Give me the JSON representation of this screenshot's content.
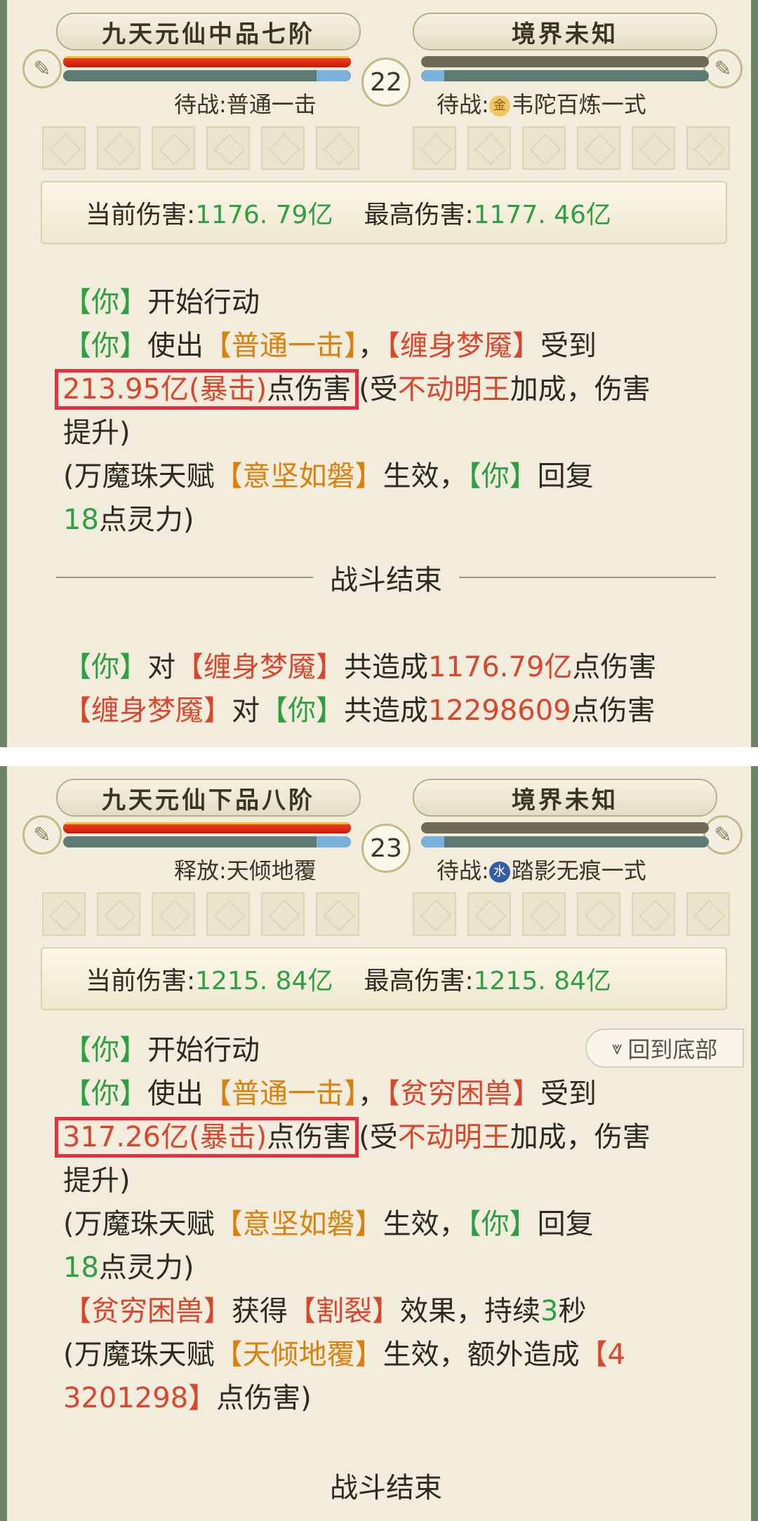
{
  "screens": [
    {
      "player_realm": "九天元仙中品七阶",
      "enemy_realm": "境界未知",
      "round": "22",
      "player_status": "待战:普通一击",
      "enemy_status_prefix": "待战:",
      "enemy_element": "金",
      "enemy_skill": "韦陀百炼一式",
      "current_label": "当前伤害:",
      "current_value": "1176. 79亿",
      "max_label": "最高伤害:",
      "max_value": "1177. 46亿",
      "log": {
        "l1_you": "【你】",
        "l1_text": "开始行动",
        "l2_you": "【你】",
        "l2_use": "使出",
        "l2_skill": "【普通一击】",
        "l2_comma": "，",
        "l2_enemy": "【缠身梦魇】",
        "l2_recv": "受到",
        "l3_crit": "213.95亿(暴击)",
        "l3_crit_tail": "点伤害",
        "l3_open": "(受",
        "l3_buff": "不动明王",
        "l3_rest": "加成，伤害",
        "l4": "提升)",
        "l5_open": "(万魔珠天赋",
        "l5_talent": "【意坚如磐】",
        "l5_mid": "生效，",
        "l5_you": "【你】",
        "l5_end": "回复",
        "l6_num": "18",
        "l6_end": "点灵力)"
      },
      "divider": "战斗结束",
      "summary": {
        "s1_you": "【你】",
        "s1_to": "对",
        "s1_enemy": "【缠身梦魇】",
        "s1_total": "共造成",
        "s1_value": "1176.79亿",
        "s1_tail": "点伤害",
        "s2_enemy": "【缠身梦魇】",
        "s2_to": "对",
        "s2_you": "【你】",
        "s2_total": "共造成",
        "s2_value": "12298609",
        "s2_tail": "点伤害"
      }
    },
    {
      "player_realm": "九天元仙下品八阶",
      "enemy_realm": "境界未知",
      "round": "23",
      "player_status": "释放:天倾地覆",
      "enemy_status_prefix": "待战:",
      "enemy_element": "水",
      "enemy_skill": "踏影无痕一式",
      "current_label": "当前伤害:",
      "current_value": "1215. 84亿",
      "max_label": "最高伤害:",
      "max_value": "1215. 84亿",
      "back_to_bottom": "回到底部",
      "log": {
        "l1_you": "【你】",
        "l1_text": "开始行动",
        "l2_you": "【你】",
        "l2_use": "使出",
        "l2_skill": "【普通一击】",
        "l2_comma": "，",
        "l2_enemy": "【贫穷困兽】",
        "l2_recv": "受到",
        "l3_crit": "317.26亿(暴击)",
        "l3_crit_tail": "点伤害",
        "l3_open": "(受",
        "l3_buff": "不动明王",
        "l3_rest": "加成，伤害",
        "l4": "提升)",
        "l5_open": "(万魔珠天赋",
        "l5_talent": "【意坚如磐】",
        "l5_mid": "生效，",
        "l5_you": "【你】",
        "l5_end": "回复",
        "l6_num": "18",
        "l6_end": "点灵力)",
        "l7_enemy": "【贫穷困兽】",
        "l7_get": "获得",
        "l7_effect": "【割裂】",
        "l7_mid": "效果，持续",
        "l7_num": "3",
        "l7_end": "秒",
        "l8_open": "(万魔珠天赋",
        "l8_talent": "【天倾地覆】",
        "l8_mid": "生效，额外造成",
        "l8_val1": "【4",
        "l9_val2": "3201298】",
        "l9_end": "点伤害)"
      },
      "divider": "战斗结束"
    }
  ]
}
